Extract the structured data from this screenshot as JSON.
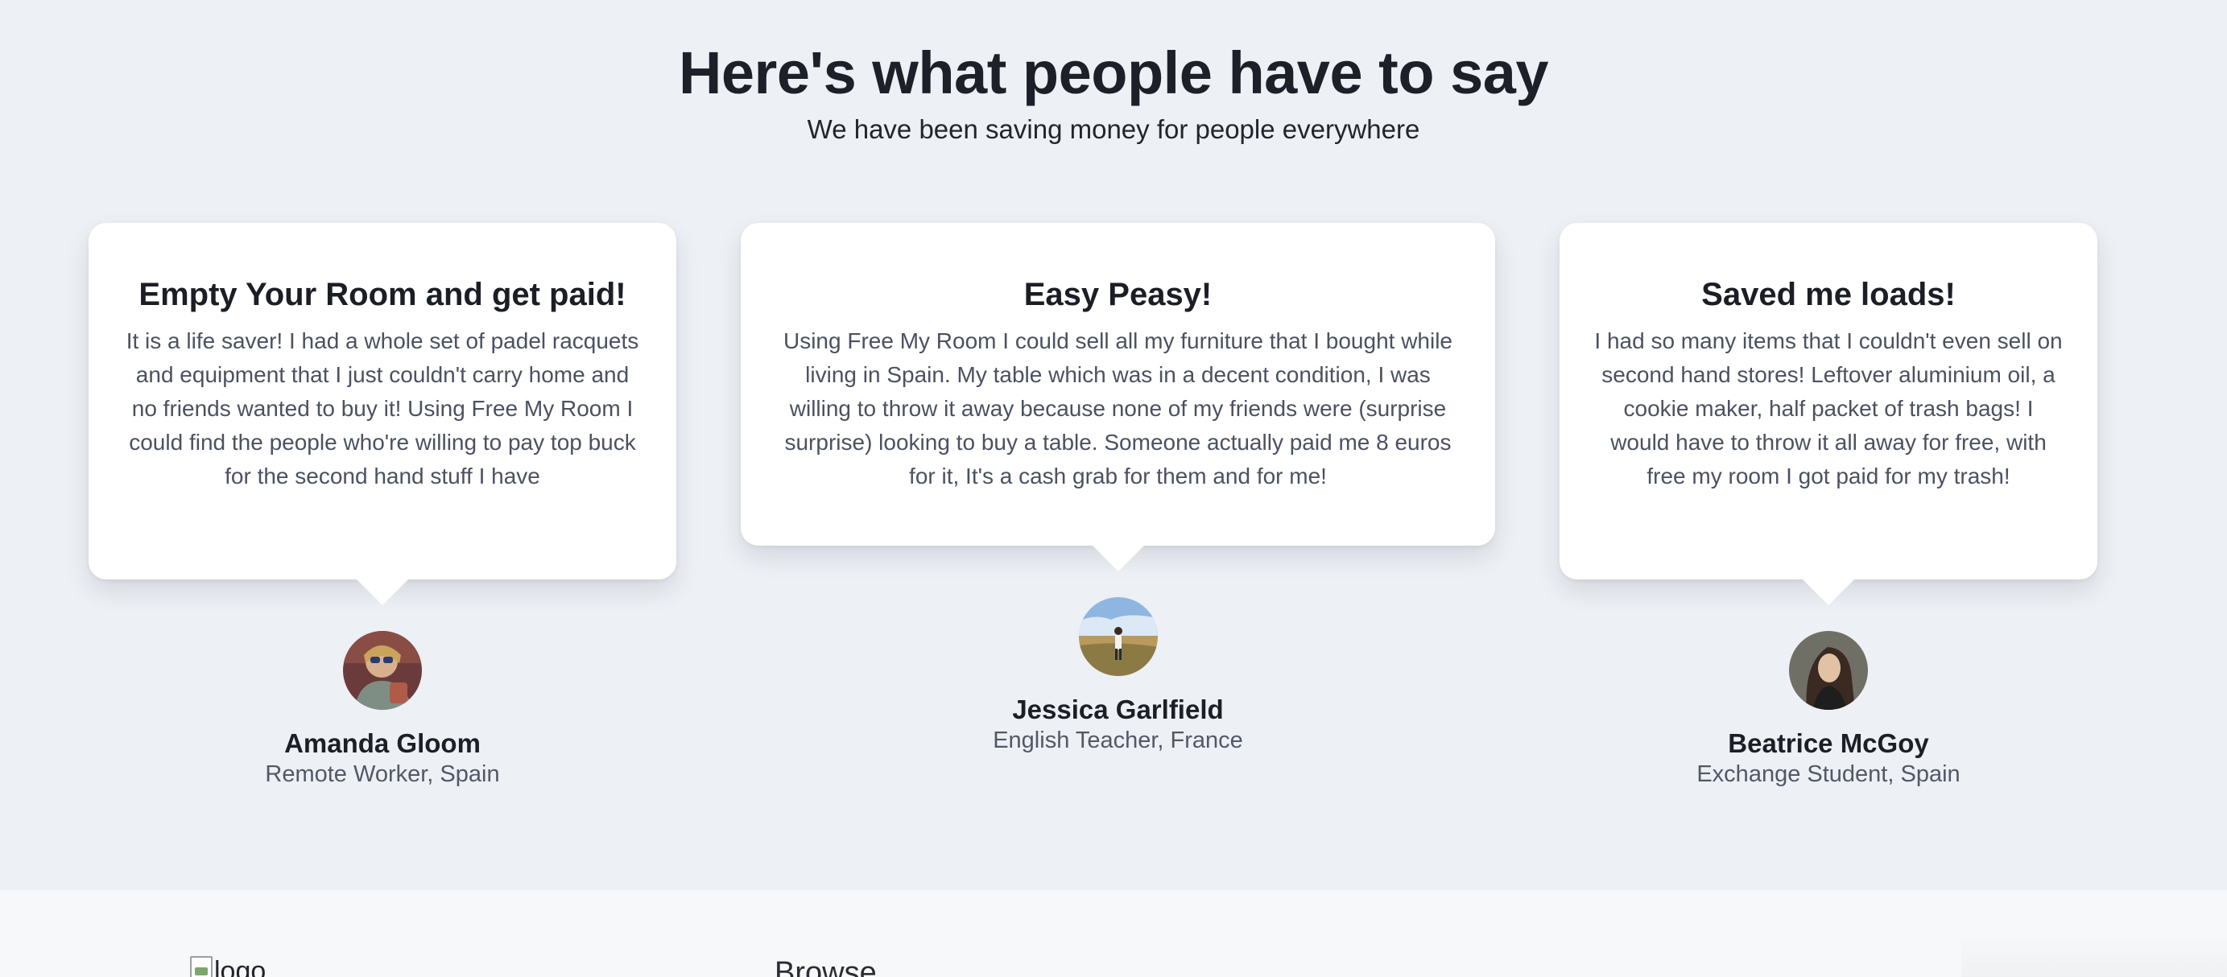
{
  "header": {
    "title": "Here's what people have to say",
    "subtitle": "We have been saving money for people everywhere"
  },
  "testimonials": [
    {
      "title": "Empty Your Room and get paid!",
      "text": "It is a life saver! I had a whole set of padel racquets and equipment that I just couldn't carry home and no friends wanted to buy it! Using Free My Room I could find the people who're willing to pay top buck for the second hand stuff I have",
      "name": "Amanda Gloom",
      "role": "Remote Worker, Spain"
    },
    {
      "title": "Easy Peasy!",
      "text": "Using Free My Room I could sell all my furniture that I bought while living in Spain. My table which was in a decent condition, I was willing to throw it away because none of my friends were (surprise surprise) looking to buy a table. Someone actually paid me 8 euros for it, It's a cash grab for them and for me!",
      "name": "Jessica Garlfield",
      "role": "English Teacher, France"
    },
    {
      "title": "Saved me loads!",
      "text": "I had so many items that I couldn't even sell on second hand stores! Leftover aluminium oil, a cookie maker, half packet of trash bags! I would have to throw it all away for free, with free my room I got paid for my trash!",
      "name": "Beatrice McGoy",
      "role": "Exchange Student, Spain"
    }
  ],
  "footer": {
    "logo_alt": "logo",
    "browse_heading": "Browse"
  },
  "colors": {
    "page_background": "#edf0f5",
    "card_background": "#ffffff",
    "footer_background": "#f7f8fa",
    "heading_text": "#1d2029",
    "body_text": "#4b5160"
  }
}
